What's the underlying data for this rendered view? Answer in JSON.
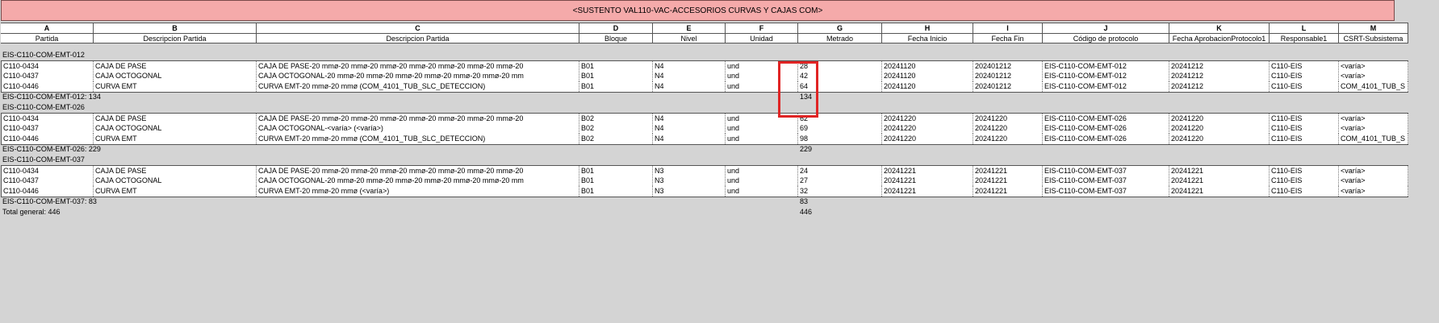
{
  "title": "<SUSTENTO VAL110-VAC-ACCESORIOS CURVAS Y CAJAS COM>",
  "column_letters": [
    "A",
    "B",
    "C",
    "D",
    "E",
    "F",
    "G",
    "H",
    "I",
    "J",
    "K",
    "L",
    "M"
  ],
  "column_headers": [
    "Partida",
    "Descripcion Partida",
    "Descripcion Partida",
    "Bloque",
    "Nivel",
    "Unidad",
    "Metrado",
    "Fecha Inicio",
    "Fecha Fin",
    "Código de protocolo",
    "Fecha AprobacionProtocolo1",
    "Responsable1",
    "CSRT-Subsistema"
  ],
  "groups": [
    {
      "name": "EIS-C110-COM-EMT-012",
      "rows": [
        [
          "C110-0434",
          "CAJA DE PASE",
          "CAJA DE PASE-20 mmø-20 mmø-20 mmø-20 mmø-20 mmø-20 mmø-20 mmø-20",
          "B01",
          "N4",
          "und",
          "28",
          "20241120",
          "202401212",
          "EIS-C110-COM-EMT-012",
          "20241212",
          "C110-EIS",
          "<varía>"
        ],
        [
          "C110-0437",
          "CAJA OCTOGONAL",
          "CAJA OCTOGONAL-20 mmø-20 mmø-20 mmø-20 mmø-20 mmø-20 mmø-20 mm",
          "B01",
          "N4",
          "und",
          "42",
          "20241120",
          "202401212",
          "EIS-C110-COM-EMT-012",
          "20241212",
          "C110-EIS",
          "<varía>"
        ],
        [
          "C110-0446",
          "CURVA EMT",
          "CURVA EMT-20 mmø-20 mmø (COM_4101_TUB_SLC_DETECCION)",
          "B01",
          "N4",
          "und",
          "64",
          "20241120",
          "202401212",
          "EIS-C110-COM-EMT-012",
          "20241212",
          "C110-EIS",
          "COM_4101_TUB_S"
        ]
      ],
      "subtotal_label": "EIS-C110-COM-EMT-012: 134",
      "subtotal_value": "134"
    },
    {
      "name": "EIS-C110-COM-EMT-026",
      "rows": [
        [
          "C110-0434",
          "CAJA DE PASE",
          "CAJA DE PASE-20 mmø-20 mmø-20 mmø-20 mmø-20 mmø-20 mmø-20 mmø-20",
          "B02",
          "N4",
          "und",
          "62",
          "20241220",
          "20241220",
          "EIS-C110-COM-EMT-026",
          "20241220",
          "C110-EIS",
          "<varía>"
        ],
        [
          "C110-0437",
          "CAJA OCTOGONAL",
          "CAJA OCTOGONAL-<varía> (<varía>)",
          "B02",
          "N4",
          "und",
          "69",
          "20241220",
          "20241220",
          "EIS-C110-COM-EMT-026",
          "20241220",
          "C110-EIS",
          "<varía>"
        ],
        [
          "C110-0446",
          "CURVA EMT",
          "CURVA EMT-20 mmø-20 mmø (COM_4101_TUB_SLC_DETECCION)",
          "B02",
          "N4",
          "und",
          "98",
          "20241220",
          "20241220",
          "EIS-C110-COM-EMT-026",
          "20241220",
          "C110-EIS",
          "COM_4101_TUB_S"
        ]
      ],
      "subtotal_label": "EIS-C110-COM-EMT-026: 229",
      "subtotal_value": "229"
    },
    {
      "name": "EIS-C110-COM-EMT-037",
      "rows": [
        [
          "C110-0434",
          "CAJA DE PASE",
          "CAJA DE PASE-20 mmø-20 mmø-20 mmø-20 mmø-20 mmø-20 mmø-20 mmø-20",
          "B01",
          "N3",
          "und",
          "24",
          "20241221",
          "20241221",
          "EIS-C110-COM-EMT-037",
          "20241221",
          "C110-EIS",
          "<varía>"
        ],
        [
          "C110-0437",
          "CAJA OCTOGONAL",
          "CAJA OCTOGONAL-20 mmø-20 mmø-20 mmø-20 mmø-20 mmø-20 mmø-20 mm",
          "B01",
          "N3",
          "und",
          "27",
          "20241221",
          "20241221",
          "EIS-C110-COM-EMT-037",
          "20241221",
          "C110-EIS",
          "<varía>"
        ],
        [
          "C110-0446",
          "CURVA EMT",
          "CURVA EMT-20 mmø-20 mmø (<varía>)",
          "B01",
          "N3",
          "und",
          "32",
          "20241221",
          "20241221",
          "EIS-C110-COM-EMT-037",
          "20241221",
          "C110-EIS",
          "<varía>"
        ]
      ],
      "subtotal_label": "EIS-C110-COM-EMT-037: 83",
      "subtotal_value": "83"
    }
  ],
  "grand_total_label": "Total general: 446",
  "grand_total_value": "446",
  "colors": {
    "title_bg": "#f5aaaa",
    "highlight": "#e02424",
    "background": "#d4d4d4"
  }
}
